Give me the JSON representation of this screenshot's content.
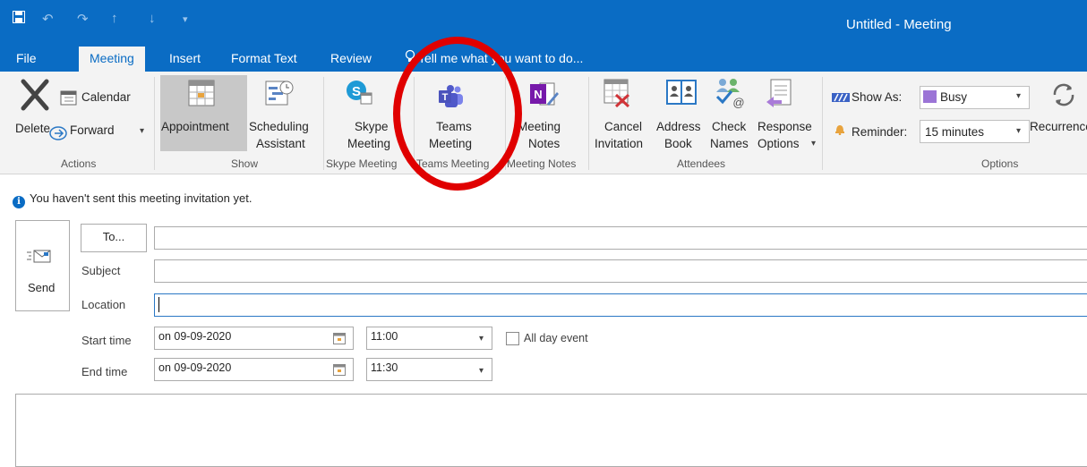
{
  "window": {
    "title": "Untitled - Meeting"
  },
  "tabs": [
    "File",
    "Meeting",
    "Insert",
    "Format Text",
    "Review"
  ],
  "tell_me": "Tell me what you want to do...",
  "ribbon": {
    "actions": {
      "delete": "Delete",
      "calendar": "Calendar",
      "forward": "Forward",
      "group": "Actions"
    },
    "show": {
      "appointment": "Appointment",
      "scheduling_1": "Scheduling",
      "scheduling_2": "Assistant",
      "group": "Show"
    },
    "skype": {
      "line1": "Skype",
      "line2": "Meeting",
      "group": "Skype Meeting"
    },
    "teams": {
      "line1": "Teams",
      "line2": "Meeting",
      "group": "Teams Meeting"
    },
    "notes": {
      "line1": "Meeting",
      "line2": "Notes",
      "group": "Meeting Notes"
    },
    "attendees": {
      "cancel_1": "Cancel",
      "cancel_2": "Invitation",
      "address_1": "Address",
      "address_2": "Book",
      "check_1": "Check",
      "check_2": "Names",
      "response_1": "Response",
      "response_2": "Options",
      "group": "Attendees"
    },
    "options": {
      "show_as_label": "Show As:",
      "show_as_value": "Busy",
      "reminder_label": "Reminder:",
      "reminder_value": "15 minutes",
      "recurrence": "Recurrence",
      "group": "Options"
    }
  },
  "info_bar": "You haven't sent this meeting invitation yet.",
  "form": {
    "send": "Send",
    "to": "To...",
    "subject_label": "Subject",
    "location_label": "Location",
    "start_label": "Start time",
    "end_label": "End time",
    "start_date": "on 09-09-2020",
    "start_time": "11:00",
    "end_date": "on 09-09-2020",
    "end_time": "11:30",
    "all_day": "All day event"
  },
  "colors": {
    "accent": "#0a6cc4",
    "highlight_circle": "#e00000",
    "busy": "#9b74d6"
  }
}
